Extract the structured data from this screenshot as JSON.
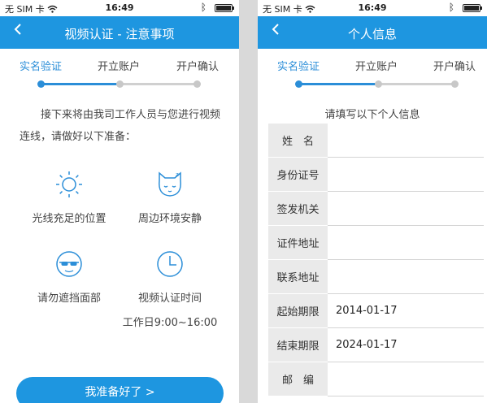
{
  "status": {
    "carrier": "无 SIM 卡",
    "time": "16:49"
  },
  "screens": {
    "left": {
      "title": "视频认证 - 注意事项",
      "steps": [
        "实名验证",
        "开立账户",
        "开户确认"
      ],
      "intro": "接下来将由我司工作人员与您进行视频连线，请做好以下准备：",
      "features": [
        {
          "label": "光线充足的位置",
          "icon": "sun-icon"
        },
        {
          "label": "周边环境安静",
          "icon": "sleeping-cat-icon"
        },
        {
          "label": "请勿遮挡面部",
          "icon": "face-sunglasses-icon"
        },
        {
          "label": "视频认证时间",
          "icon": "clock-icon",
          "sub": "工作日9:00~16:00"
        }
      ],
      "button": "我准备好了 >"
    },
    "right": {
      "title": "个人信息",
      "steps": [
        "实名验证",
        "开立账户",
        "开户确认"
      ],
      "hint": "请填写以下个人信息",
      "fields": [
        {
          "label": "姓　名",
          "value": ""
        },
        {
          "label": "身份证号",
          "value": ""
        },
        {
          "label": "签发机关",
          "value": ""
        },
        {
          "label": "证件地址",
          "value": ""
        },
        {
          "label": "联系地址",
          "value": ""
        },
        {
          "label": "起始期限",
          "value": "2014-01-17"
        },
        {
          "label": "结束期限",
          "value": "2024-01-17"
        },
        {
          "label": "邮　编",
          "value": ""
        }
      ]
    }
  },
  "colors": {
    "primary": "#1e96e0",
    "step_active": "#2b8ed8",
    "step_inactive": "#d0d0d0",
    "label_bg": "#eaeaea",
    "backdrop": "#d9d9d9"
  }
}
